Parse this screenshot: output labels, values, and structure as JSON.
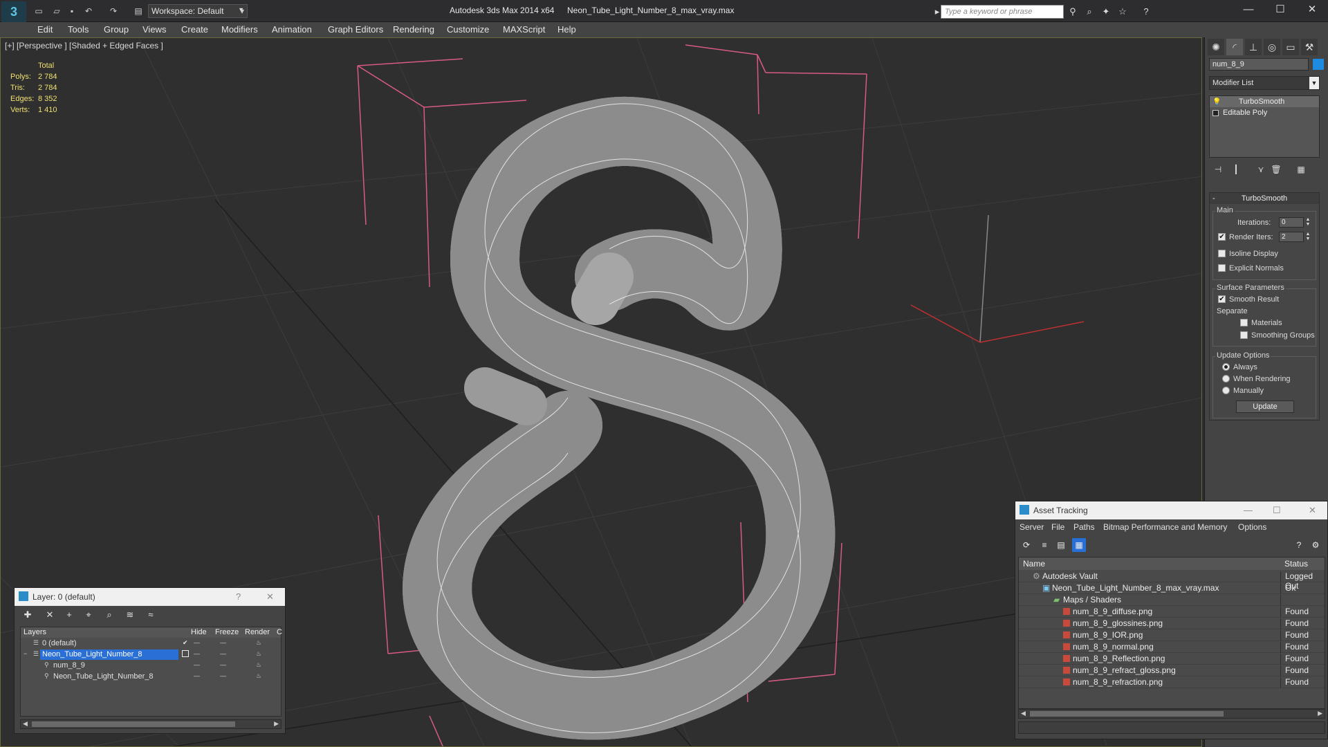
{
  "titlebar": {
    "app_title": "Autodesk 3ds Max  2014 x64",
    "file_title": "Neon_Tube_Light_Number_8_max_vray.max",
    "workspace": "Workspace: Default",
    "search_placeholder": "Type a keyword or phrase",
    "window_controls": [
      "—",
      "☐",
      "✕"
    ]
  },
  "menubar": {
    "items": [
      "Edit",
      "Tools",
      "Group",
      "Views",
      "Create",
      "Modifiers",
      "Animation",
      "Graph Editors",
      "Rendering",
      "Customize",
      "MAXScript",
      "Help"
    ]
  },
  "viewport": {
    "label": "[+] [Perspective ] [Shaded + Edged Faces ]",
    "stats": {
      "header": "Total",
      "rows": [
        {
          "k": "Polys:",
          "v": "2 784"
        },
        {
          "k": "Tris:",
          "v": "2 784"
        },
        {
          "k": "Edges:",
          "v": "8 352"
        },
        {
          "k": "Verts:",
          "v": "1 410"
        }
      ]
    }
  },
  "command_panel": {
    "object_name": "num_8_9",
    "object_color": "#1e8be0",
    "modifier_list": "Modifier List",
    "stack": [
      "TurboSmooth",
      "Editable Poly"
    ],
    "rollout_title": "TurboSmooth",
    "main_group": "Main",
    "iterations_label": "Iterations:",
    "iterations_value": "0",
    "render_iters_label": "Render Iters:",
    "render_iters_value": "2",
    "isoline_label": "Isoline Display",
    "explicit_normals_label": "Explicit Normals",
    "surface_group": "Surface Parameters",
    "smooth_result_label": "Smooth Result",
    "separate_label": "Separate",
    "materials_label": "Materials",
    "smoothing_groups_label": "Smoothing Groups",
    "update_group": "Update Options",
    "always_label": "Always",
    "when_rendering_label": "When Rendering",
    "manually_label": "Manually",
    "update_button": "Update"
  },
  "layer_window": {
    "title": "Layer: 0 (default)",
    "help": "?",
    "close": "✕",
    "columns": [
      "Layers",
      "Hide",
      "Freeze",
      "Render",
      "C"
    ],
    "rows": [
      {
        "name": "0 (default)"
      },
      {
        "name": "Neon_Tube_Light_Number_8"
      },
      {
        "name": "num_8_9"
      },
      {
        "name": "Neon_Tube_Light_Number_8"
      }
    ]
  },
  "asset_window": {
    "title": "Asset Tracking",
    "menu": [
      "Server",
      "File",
      "Paths",
      "Bitmap Performance and Memory",
      "Options"
    ],
    "columns": [
      "Name",
      "Status"
    ],
    "rows": [
      {
        "name": "Autodesk Vault",
        "status": "Logged Out"
      },
      {
        "name": "Neon_Tube_Light_Number_8_max_vray.max",
        "status": "Ok"
      },
      {
        "name": "Maps / Shaders",
        "status": ""
      },
      {
        "name": "num_8_9_diffuse.png",
        "status": "Found"
      },
      {
        "name": "num_8_9_glossines.png",
        "status": "Found"
      },
      {
        "name": "num_8_9_IOR.png",
        "status": "Found"
      },
      {
        "name": "num_8_9_normal.png",
        "status": "Found"
      },
      {
        "name": "num_8_9_Reflection.png",
        "status": "Found"
      },
      {
        "name": "num_8_9_refract_gloss.png",
        "status": "Found"
      },
      {
        "name": "num_8_9_refraction.png",
        "status": "Found"
      }
    ]
  }
}
